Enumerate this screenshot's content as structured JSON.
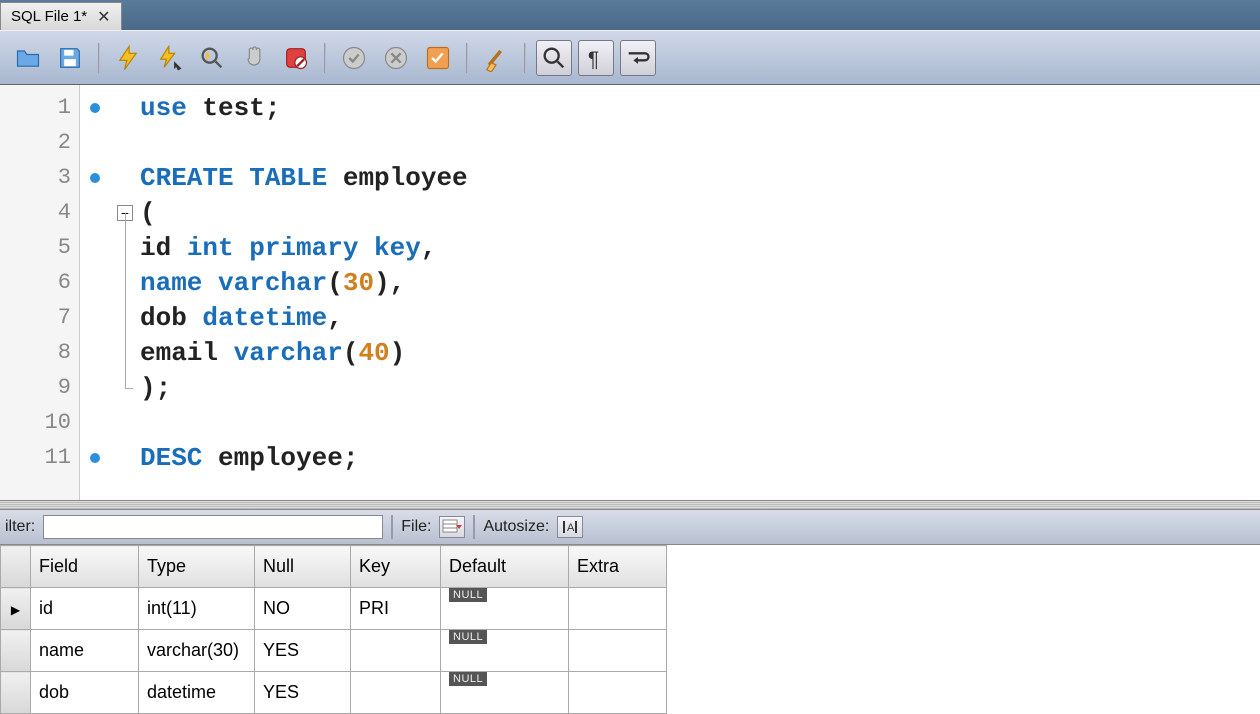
{
  "tab": {
    "title": "SQL File 1*"
  },
  "editor": {
    "lines": [
      {
        "n": 1,
        "dot": true,
        "tokens": [
          {
            "t": "use",
            "c": "kw"
          },
          {
            "t": " test;",
            "c": "txt"
          }
        ]
      },
      {
        "n": 2,
        "dot": false,
        "tokens": []
      },
      {
        "n": 3,
        "dot": true,
        "tokens": [
          {
            "t": "CREATE TABLE",
            "c": "kw"
          },
          {
            "t": " employee",
            "c": "txt"
          }
        ]
      },
      {
        "n": 4,
        "dot": false,
        "fold": "box",
        "tokens": [
          {
            "t": "(",
            "c": "txt"
          }
        ]
      },
      {
        "n": 5,
        "dot": false,
        "fold": "line",
        "tokens": [
          {
            "t": "id ",
            "c": "txt"
          },
          {
            "t": "int primary key",
            "c": "kw"
          },
          {
            "t": ",",
            "c": "txt"
          }
        ]
      },
      {
        "n": 6,
        "dot": false,
        "fold": "line",
        "tokens": [
          {
            "t": "name varchar",
            "c": "kw"
          },
          {
            "t": "(",
            "c": "txt"
          },
          {
            "t": "30",
            "c": "str-num"
          },
          {
            "t": "),",
            "c": "txt"
          }
        ]
      },
      {
        "n": 7,
        "dot": false,
        "fold": "line",
        "tokens": [
          {
            "t": "dob ",
            "c": "txt"
          },
          {
            "t": "datetime",
            "c": "kw"
          },
          {
            "t": ",",
            "c": "txt"
          }
        ]
      },
      {
        "n": 8,
        "dot": false,
        "fold": "line",
        "tokens": [
          {
            "t": "email ",
            "c": "txt"
          },
          {
            "t": "varchar",
            "c": "kw"
          },
          {
            "t": "(",
            "c": "txt"
          },
          {
            "t": "40",
            "c": "str-num"
          },
          {
            "t": ")",
            "c": "txt"
          }
        ]
      },
      {
        "n": 9,
        "dot": false,
        "fold": "end",
        "tokens": [
          {
            "t": ");",
            "c": "txt"
          }
        ]
      },
      {
        "n": 10,
        "dot": false,
        "tokens": []
      },
      {
        "n": 11,
        "dot": true,
        "tokens": [
          {
            "t": "DESC",
            "c": "kw"
          },
          {
            "t": " employee;",
            "c": "txt"
          }
        ]
      }
    ]
  },
  "results": {
    "filter_label": "ilter:",
    "file_label": "File:",
    "autosize_label": "Autosize:",
    "columns": [
      "Field",
      "Type",
      "Null",
      "Key",
      "Default",
      "Extra"
    ],
    "rows": [
      {
        "active": true,
        "Field": "id",
        "Type": "int(11)",
        "Null": "NO",
        "Key": "PRI",
        "Default": "NULL",
        "Extra": ""
      },
      {
        "active": false,
        "Field": "name",
        "Type": "varchar(30)",
        "Null": "YES",
        "Key": "",
        "Default": "NULL",
        "Extra": ""
      },
      {
        "active": false,
        "Field": "dob",
        "Type": "datetime",
        "Null": "YES",
        "Key": "",
        "Default": "NULL",
        "Extra": ""
      }
    ]
  }
}
